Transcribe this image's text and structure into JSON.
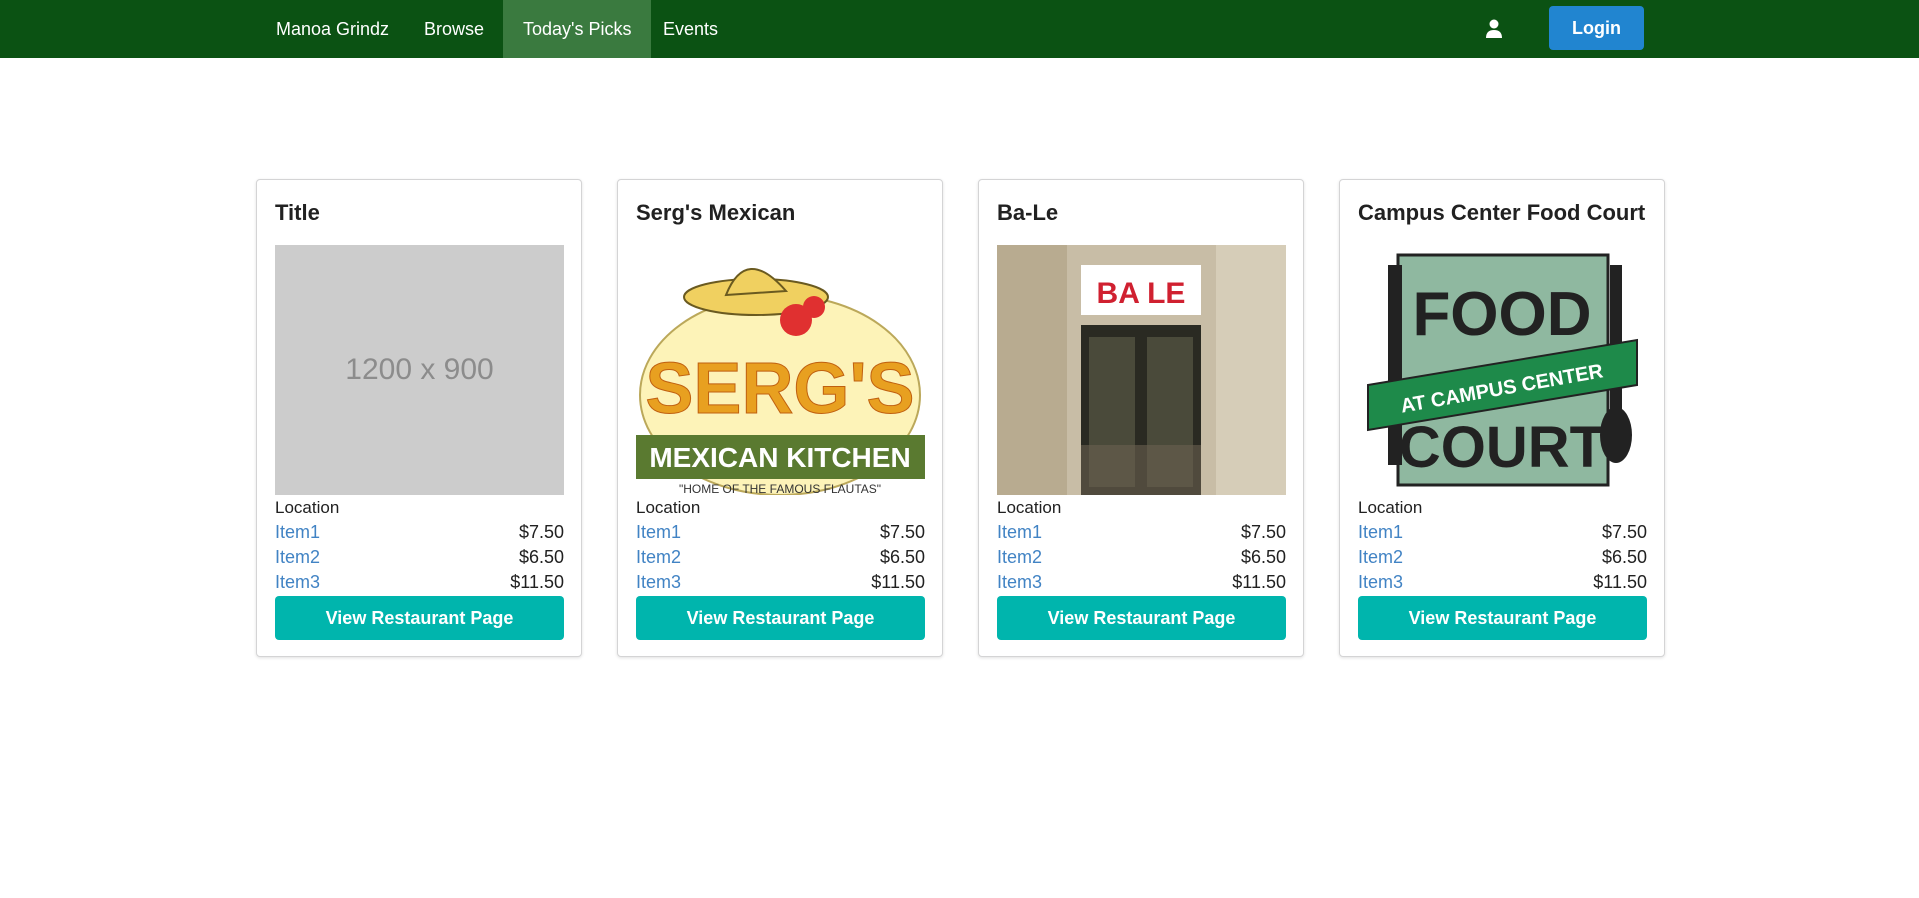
{
  "navbar": {
    "brand": "Manoa Grindz",
    "links": [
      {
        "label": "Browse"
      },
      {
        "label": "Today's Picks",
        "active": true
      },
      {
        "label": "Events"
      }
    ],
    "user_icon": "user-icon",
    "login_label": "Login"
  },
  "colors": {
    "navbar": "#0b5213",
    "active_tab": "#3a7a3f",
    "login": "#2185d0",
    "view_button": "#00b5ad",
    "link": "#4183c4"
  },
  "cards": [
    {
      "title": "Title",
      "image_text": "1200 x 900",
      "location": "Location",
      "items": [
        {
          "name": "Item1",
          "price": "$7.50"
        },
        {
          "name": "Item2",
          "price": "$6.50"
        },
        {
          "name": "Item3",
          "price": "$11.50"
        }
      ],
      "button": "View Restaurant Page"
    },
    {
      "title": "Serg's Mexican",
      "image_logo_text": {
        "main": "SERG'S",
        "sub": "MEXICAN KITCHEN",
        "tagline": "\"HOME OF THE FAMOUS FLAUTAS\""
      },
      "location": "Location",
      "items": [
        {
          "name": "Item1",
          "price": "$7.50"
        },
        {
          "name": "Item2",
          "price": "$6.50"
        },
        {
          "name": "Item3",
          "price": "$11.50"
        }
      ],
      "button": "View Restaurant Page"
    },
    {
      "title": "Ba-Le",
      "image_sign_text": "BA LE",
      "location": "Location",
      "items": [
        {
          "name": "Item1",
          "price": "$7.50"
        },
        {
          "name": "Item2",
          "price": "$6.50"
        },
        {
          "name": "Item3",
          "price": "$11.50"
        }
      ],
      "button": "View Restaurant Page"
    },
    {
      "title": "Campus Center Food Court",
      "image_logo_text": {
        "top": "FOOD",
        "banner": "AT CAMPUS CENTER",
        "bottom": "COURT"
      },
      "location": "Location",
      "items": [
        {
          "name": "Item1",
          "price": "$7.50"
        },
        {
          "name": "Item2",
          "price": "$6.50"
        },
        {
          "name": "Item3",
          "price": "$11.50"
        }
      ],
      "button": "View Restaurant Page"
    }
  ]
}
